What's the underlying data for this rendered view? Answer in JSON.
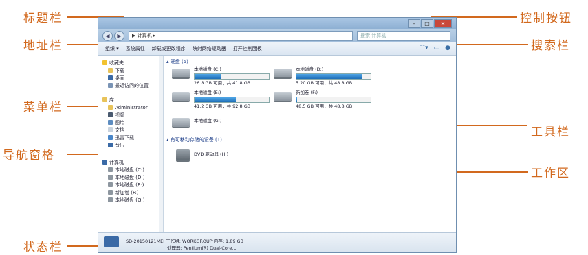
{
  "callouts": {
    "title_bar": "标题栏",
    "address_bar": "地址栏",
    "menu_bar": "菜单栏",
    "nav_pane": "导航窗格",
    "status_bar": "状态栏",
    "control_buttons": "控制按钮",
    "search_bar": "搜索栏",
    "toolbar": "工具栏",
    "work_area": "工作区"
  },
  "window": {
    "address": "▶ 计算机 ▸",
    "search_placeholder": "搜索 计算机",
    "toolbar_items": [
      "组织 ▾",
      "系统属性",
      "卸载或更改程序",
      "映射网络驱动器",
      "打开控制面板"
    ],
    "nav": {
      "favorites": [
        "收藏夹",
        "下载",
        "桌面",
        "最近访问的位置"
      ],
      "library": [
        "库",
        "Administrator",
        "视频",
        "图片",
        "文档",
        "迅雷下载",
        "音乐"
      ],
      "computer": [
        "计算机",
        "本地磁盘 (C:)",
        "本地磁盘 (D:)",
        "本地磁盘 (E:)",
        "新加卷 (F:)",
        "本地磁盘 (G:)"
      ]
    },
    "sections": {
      "hdd": "▴ 硬盘 (5)",
      "removable": "▴ 有可移动存储的设备 (1)"
    },
    "drives": [
      {
        "name": "本地磁盘 (C:)",
        "free": "26.8 GB 可用，共 41.8 GB",
        "used_fraction": 0.36
      },
      {
        "name": "本地磁盘 (D:)",
        "free": "5.20 GB 可用，共 48.8 GB",
        "used_fraction": 0.89
      },
      {
        "name": "本地磁盘 (E:)",
        "free": "41.2 GB 可用，共 92.8 GB",
        "used_fraction": 0.56
      },
      {
        "name": "新加卷 (F:)",
        "free": "48.5 GB 可用，共 48.8 GB",
        "used_fraction": 0.01
      },
      {
        "name": "本地磁盘 (G:)"
      }
    ],
    "dvd": "DVD 驱动器 (H:)",
    "status": {
      "line1": "SD-20150121MEI  工作组: WORKGROUP        内存: 1.89 GB",
      "line2": "处理器: Pentium(R) Dual-Core..."
    },
    "colors": {
      "accent": "#d2691e",
      "fill": "#1e6fb8"
    }
  }
}
